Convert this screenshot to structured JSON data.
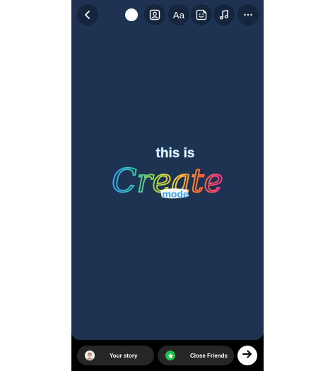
{
  "toolbar": {
    "text_button_label": "Aa",
    "draw_color": "#ffffff"
  },
  "sticker": {
    "line1": "this is",
    "line2": "Create",
    "line3": "mode"
  },
  "bottom": {
    "your_story_label": "Your story",
    "close_friends_label": "Close Friends",
    "close_friends_color": "#1fc14c"
  },
  "colors": {
    "canvas_bg": "#1e3352",
    "pill_bg": "#262626"
  }
}
